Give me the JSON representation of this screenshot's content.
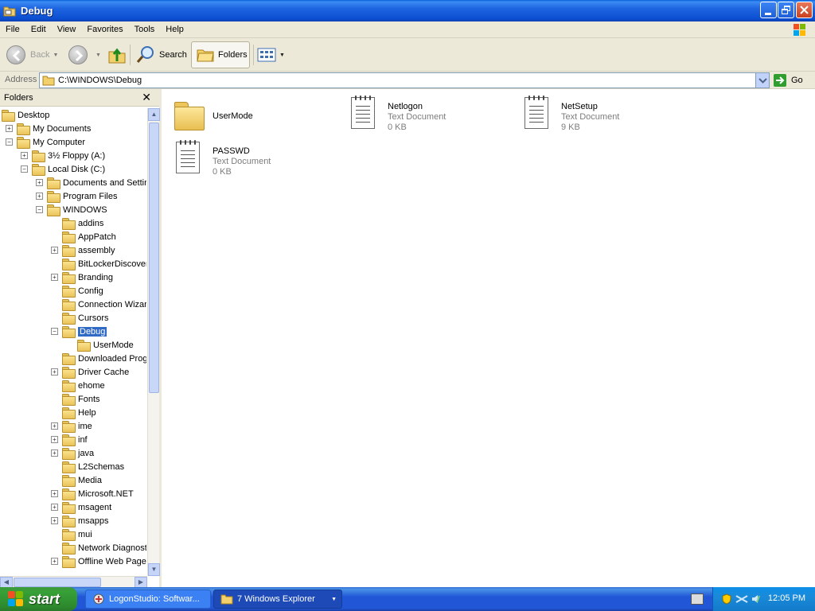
{
  "window": {
    "title": "Debug"
  },
  "menu": [
    "File",
    "Edit",
    "View",
    "Favorites",
    "Tools",
    "Help"
  ],
  "toolbar": {
    "back": "Back",
    "search": "Search",
    "folders": "Folders"
  },
  "address": {
    "label": "Address",
    "value": "C:\\WINDOWS\\Debug",
    "go": "Go"
  },
  "folders_pane": {
    "title": "Folders",
    "close": "✕",
    "tree": [
      {
        "label": "Desktop",
        "depth": 0,
        "expander": ""
      },
      {
        "label": "My Documents",
        "depth": 1,
        "expander": "+"
      },
      {
        "label": "My Computer",
        "depth": 1,
        "expander": "−"
      },
      {
        "label": "3½ Floppy (A:)",
        "depth": 2,
        "expander": "+"
      },
      {
        "label": "Local Disk (C:)",
        "depth": 2,
        "expander": "−"
      },
      {
        "label": "Documents and Settir",
        "depth": 3,
        "expander": "+"
      },
      {
        "label": "Program Files",
        "depth": 3,
        "expander": "+"
      },
      {
        "label": "WINDOWS",
        "depth": 3,
        "expander": "−"
      },
      {
        "label": "addins",
        "depth": 4,
        "expander": ""
      },
      {
        "label": "AppPatch",
        "depth": 4,
        "expander": ""
      },
      {
        "label": "assembly",
        "depth": 4,
        "expander": "+"
      },
      {
        "label": "BitLockerDiscover",
        "depth": 4,
        "expander": ""
      },
      {
        "label": "Branding",
        "depth": 4,
        "expander": "+"
      },
      {
        "label": "Config",
        "depth": 4,
        "expander": ""
      },
      {
        "label": "Connection Wizar",
        "depth": 4,
        "expander": ""
      },
      {
        "label": "Cursors",
        "depth": 4,
        "expander": ""
      },
      {
        "label": "Debug",
        "depth": 4,
        "expander": "−",
        "selected": true
      },
      {
        "label": "UserMode",
        "depth": 5,
        "expander": ""
      },
      {
        "label": "Downloaded Prog",
        "depth": 4,
        "expander": ""
      },
      {
        "label": "Driver Cache",
        "depth": 4,
        "expander": "+"
      },
      {
        "label": "ehome",
        "depth": 4,
        "expander": ""
      },
      {
        "label": "Fonts",
        "depth": 4,
        "expander": ""
      },
      {
        "label": "Help",
        "depth": 4,
        "expander": ""
      },
      {
        "label": "ime",
        "depth": 4,
        "expander": "+"
      },
      {
        "label": "inf",
        "depth": 4,
        "expander": "+"
      },
      {
        "label": "java",
        "depth": 4,
        "expander": "+"
      },
      {
        "label": "L2Schemas",
        "depth": 4,
        "expander": ""
      },
      {
        "label": "Media",
        "depth": 4,
        "expander": ""
      },
      {
        "label": "Microsoft.NET",
        "depth": 4,
        "expander": "+"
      },
      {
        "label": "msagent",
        "depth": 4,
        "expander": "+"
      },
      {
        "label": "msapps",
        "depth": 4,
        "expander": "+"
      },
      {
        "label": "mui",
        "depth": 4,
        "expander": ""
      },
      {
        "label": "Network Diagnost",
        "depth": 4,
        "expander": ""
      },
      {
        "label": "Offline Web Page",
        "depth": 4,
        "expander": "+"
      }
    ]
  },
  "items": [
    {
      "name": "UserMode",
      "type": "folder",
      "type_label": "",
      "size": ""
    },
    {
      "name": "Netlogon",
      "type": "text",
      "type_label": "Text Document",
      "size": "0 KB"
    },
    {
      "name": "NetSetup",
      "type": "text",
      "type_label": "Text Document",
      "size": "9 KB"
    },
    {
      "name": "PASSWD",
      "type": "text",
      "type_label": "Text Document",
      "size": "0 KB"
    }
  ],
  "taskbar": {
    "start": "start",
    "tasks": [
      {
        "label": "LogonStudio: Softwar..."
      },
      {
        "label": "7 Windows Explorer"
      }
    ],
    "clock": "12:05 PM"
  },
  "colors": {
    "xp_blue": "#0b4fd1",
    "selection": "#316ac5",
    "start_green": "#37a037"
  }
}
